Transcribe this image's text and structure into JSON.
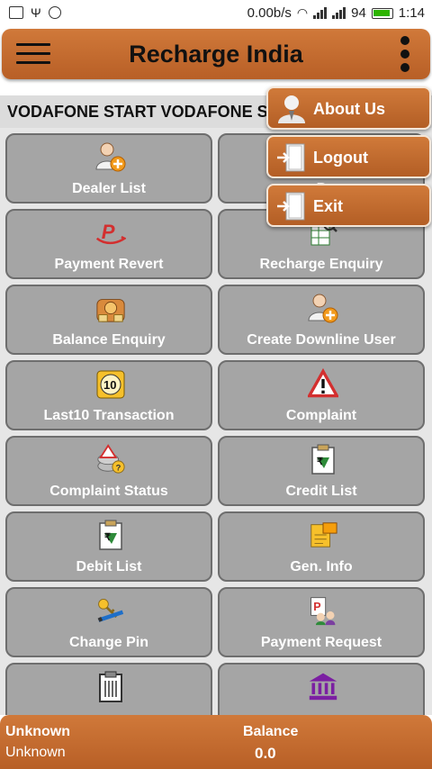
{
  "status_bar": {
    "network_speed": "0.00b/s",
    "battery_level": "94",
    "time": "1:14"
  },
  "app_bar": {
    "title": "Recharge India"
  },
  "marquee_text": "VODAFONE START VODAFONE START",
  "tiles": [
    {
      "label": "Dealer List",
      "icon": "add-user-icon"
    },
    {
      "label": "P",
      "icon": "payment-icon"
    },
    {
      "label": "Payment Revert",
      "icon": "payment-revert-icon"
    },
    {
      "label": "Recharge Enquiry",
      "icon": "spreadsheet-search-icon"
    },
    {
      "label": "Balance Enquiry",
      "icon": "money-bag-icon"
    },
    {
      "label": "Create Downline User",
      "icon": "add-user-icon"
    },
    {
      "label": "Last10 Transaction",
      "icon": "badge-10-icon"
    },
    {
      "label": "Complaint",
      "icon": "warning-icon"
    },
    {
      "label": "Complaint Status",
      "icon": "complaint-status-icon"
    },
    {
      "label": "Credit List",
      "icon": "rupee-clipboard-icon"
    },
    {
      "label": "Debit List",
      "icon": "rupee-clipboard-icon"
    },
    {
      "label": "Gen. Info",
      "icon": "info-card-icon"
    },
    {
      "label": "Change Pin",
      "icon": "key-pen-icon"
    },
    {
      "label": "Payment Request",
      "icon": "payment-request-icon"
    },
    {
      "label": "",
      "icon": "report-clipboard-icon"
    },
    {
      "label": "",
      "icon": "bank-icon"
    }
  ],
  "popup_menu": [
    {
      "label": "About Us",
      "icon": "user-icon"
    },
    {
      "label": "Logout",
      "icon": "door-exit-icon"
    },
    {
      "label": "Exit",
      "icon": "door-exit-icon"
    }
  ],
  "bottom_bar": {
    "name_label": "Unknown",
    "name_value": "Unknown",
    "balance_label": "Balance",
    "balance_value": "0.0"
  },
  "colors": {
    "accent": "#c36a2d",
    "tile": "#a5a5a5",
    "tile_border": "#6e6e6e"
  }
}
